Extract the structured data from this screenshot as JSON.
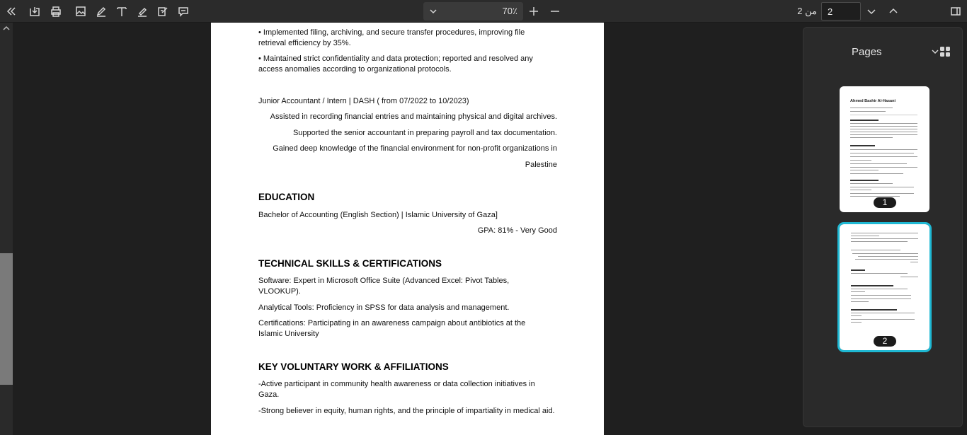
{
  "toolbar": {
    "icons": [
      "collapse-sidebar-icon",
      "save-icon",
      "print-icon",
      "image-icon",
      "draw-icon",
      "text-icon",
      "highlight-icon",
      "sign-icon",
      "comment-icon"
    ],
    "zoom_value": "70٪",
    "page_current": "2",
    "page_of": "من 2"
  },
  "sidebar": {
    "title": "Pages",
    "thumbnails": [
      {
        "number": "1",
        "title": "Ahmed Bashir Al-Hasani"
      },
      {
        "number": "2"
      }
    ]
  },
  "document": {
    "page2": {
      "bullet1": "• Implemented filing, archiving, and secure transfer procedures, improving file retrieval efficiency by 35%.",
      "bullet2": "• Maintained strict confidentiality and data protection; reported and resolved any access anomalies according to organizational protocols.",
      "job_title": "Junior Accountant / Intern | DASH ( from 07/2022 to 10/2023)",
      "job_line1": "Assisted in recording financial entries and maintaining physical and digital archives.",
      "job_line2": "Supported the senior accountant in preparing payroll and tax documentation.",
      "job_line3": "Gained deep knowledge of the financial environment for non-profit organizations in",
      "job_line4": "Palestine",
      "education_heading": "EDUCATION",
      "education_line": "Bachelor of Accounting (English Section) | Islamic University of Gaza]",
      "gpa": "GPA: 81% - Very Good",
      "skills_heading": "TECHNICAL SKILLS & CERTIFICATIONS",
      "skills_software": "Software: Expert in Microsoft Office Suite (Advanced Excel: Pivot Tables, VLOOKUP).",
      "skills_analytical": "Analytical Tools: Proficiency in SPSS for data analysis and management.",
      "skills_cert": "Certifications: Participating in an awareness campaign about antibiotics at the Islamic University",
      "volunteer_heading": "KEY VOLUNTARY WORK & AFFILIATIONS",
      "volunteer1": "-Active participant in community health awareness or data collection initiatives in Gaza.",
      "volunteer2": "-Strong believer in equity, human rights, and the principle of impartiality in medical aid."
    }
  },
  "colors": {
    "toolbar_bg": "#2b2b2b",
    "selected_outline": "#1fb8d3"
  }
}
